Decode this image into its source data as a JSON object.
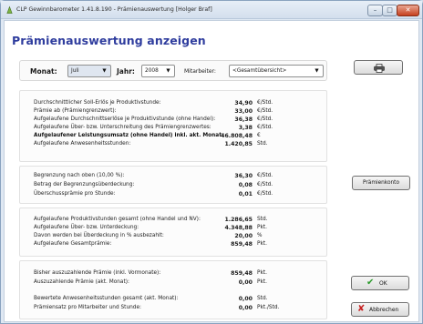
{
  "window": {
    "title": "CLP Gewinnbarometer 1.41.8.190 - Prämienauswertung  [Holger Braf]",
    "buttons": {
      "minimize": "–",
      "maximize": "□",
      "close": "✕"
    }
  },
  "heading": "Prämienauswertung anzeigen",
  "filter": {
    "monat_label": "Monat:",
    "monat_value": "Juli",
    "jahr_label": "Jahr:",
    "jahr_value": "2008",
    "mitarbeiter_label": "Mitarbeiter:",
    "mitarbeiter_value": "<Gesamtübersicht>"
  },
  "section1": [
    {
      "label": "Durchschnittlicher Soll-Erlös je Produktivstunde:",
      "value": "34,90",
      "unit": "€/Std."
    },
    {
      "label": "Prämie ab (Prämiengrenzwert):",
      "value": "33,00",
      "unit": "€/Std."
    },
    {
      "label": "Aufgelaufene Durchschnittserlöse je Produktivstunde (ohne Handel):",
      "value": "36,38",
      "unit": "€/Std."
    },
    {
      "label": "Aufgelaufene Über- bzw. Unterschreitung des Prämiengrenzwertes:",
      "value": "3,38",
      "unit": "€/Std."
    },
    {
      "label": "Aufgelaufener Leistungsumsatz (ohne Handel) inkl. akt. Monat:",
      "value": "46.808,48",
      "unit": "€"
    },
    {
      "label": "Aufgelaufene Anwesenheitsstunden:",
      "value": "1.420,85",
      "unit": "Std."
    }
  ],
  "section2": [
    {
      "label": "Begrenzung nach oben (10,00 %):",
      "value": "36,30",
      "unit": "€/Std."
    },
    {
      "label": "Betrag der Begrenzungsüberdeckung:",
      "value": "0,08",
      "unit": "€/Std."
    },
    {
      "label": "Überschussprämie pro Stunde:",
      "value": "0,01",
      "unit": "€/Std."
    }
  ],
  "section3": [
    {
      "label": "Aufgelaufene Produktivstunden gesamt (ohne Handel und NV):",
      "value": "1.286,65",
      "unit": "Std."
    },
    {
      "label": "Aufgelaufene Über- bzw. Unterdeckung:",
      "value": "4.348,88",
      "unit": "Pkt."
    },
    {
      "label": "Davon werden bei Überdeckung in % ausbezahlt:",
      "value": "20,00",
      "unit": "%"
    },
    {
      "label": "Aufgelaufene Gesamtprämie:",
      "value": "859,48",
      "unit": "Pkt."
    }
  ],
  "section4": [
    {
      "label": "Bisher auszuzahlende Prämie (inkl. Vormonate):",
      "value": "859,48",
      "unit": "Pkt."
    },
    {
      "label": "Auszuzahlende Prämie (akt. Monat):",
      "value": "0,00",
      "unit": "Pkt."
    },
    {
      "label": "Bewertete Anwesenheitsstunden gesamt (akt. Monat):",
      "value": "0,00",
      "unit": "Std."
    },
    {
      "label": "Prämiensatz pro Mitarbeiter und Stunde:",
      "value": "0,00",
      "unit": "Pkt./Std."
    }
  ],
  "buttons": {
    "print_icon": "printer-icon",
    "praemienkonto": "Prämienkonto",
    "ok": "OK",
    "abbrechen": "Abbrechen"
  },
  "colors": {
    "heading": "#2f3d9e",
    "ok_check": "#2c9b2c",
    "cancel_x": "#c62020"
  }
}
